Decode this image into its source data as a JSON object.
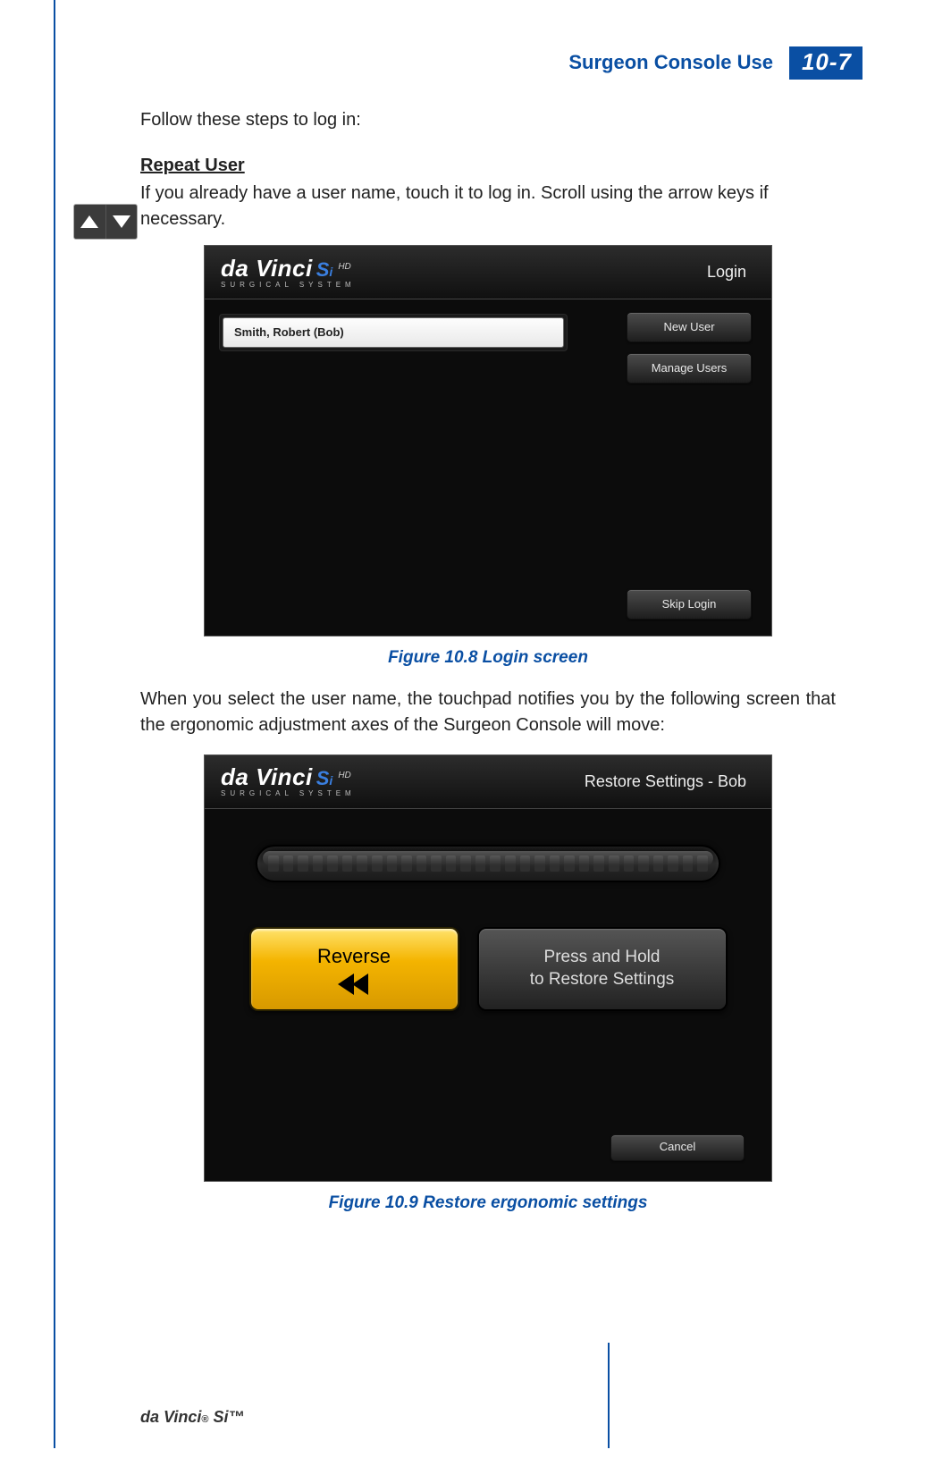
{
  "header": {
    "section_title": "Surgeon Console Use",
    "page_tag": "10-7"
  },
  "body": {
    "intro": "Follow these steps to log in:",
    "repeat_user_label": "Repeat User",
    "repeat_user_text": "If you already have a user name, touch it to log in. Scroll using the arrow keys if necessary.",
    "mid_para": "When you select the user name, the touchpad notifies you by the following screen that the ergonomic adjustment axes of the Surgeon Console will move:"
  },
  "fig1": {
    "logo_main": "da Vinci",
    "logo_si": "S",
    "logo_i": "i",
    "logo_hd": "HD",
    "logo_sub": "SURGICAL SYSTEM",
    "banner_right": "Login",
    "user_name": "Smith, Robert (Bob)",
    "new_user": "New User",
    "manage_users": "Manage Users",
    "skip_login": "Skip Login",
    "caption": "Figure 10.8 Login screen"
  },
  "fig2": {
    "banner_right": "Restore Settings - Bob",
    "reverse": "Reverse",
    "hold_line1": "Press and Hold",
    "hold_line2": "to Restore Settings",
    "cancel": "Cancel",
    "caption": "Figure 10.9 Restore ergonomic settings"
  },
  "footer": {
    "brand": "da Vinci",
    "reg": "®",
    "model": " Si™"
  }
}
